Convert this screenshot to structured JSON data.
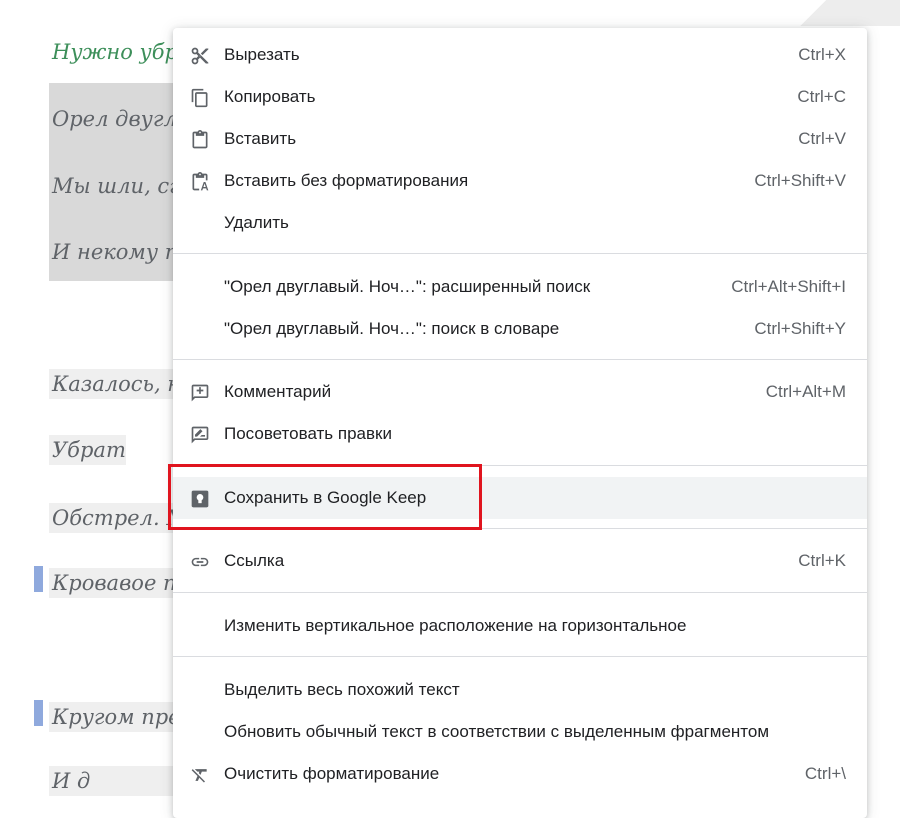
{
  "document": {
    "lines": [
      "Нужно убрать",
      "Орел двуглав",
      "Мы шли, сгу",
      "И некому по",
      "Казалось, не",
      "Убрать",
      "Обстрел. Ма",
      "Кровавое пя",
      "Кругом пред",
      "И д"
    ]
  },
  "menu": {
    "cut": {
      "label": "Вырезать",
      "shortcut": "Ctrl+X"
    },
    "copy": {
      "label": "Копировать",
      "shortcut": "Ctrl+C"
    },
    "paste": {
      "label": "Вставить",
      "shortcut": "Ctrl+V"
    },
    "paste_plain": {
      "label": "Вставить без форматирования",
      "shortcut": "Ctrl+Shift+V"
    },
    "delete": {
      "label": "Удалить"
    },
    "advanced_search": {
      "label": "\"Орел двуглавый. Ноч…\": расширенный поиск",
      "shortcut": "Ctrl+Alt+Shift+I"
    },
    "dictionary": {
      "label": "\"Орел двуглавый. Ноч…\": поиск в словаре",
      "shortcut": "Ctrl+Shift+Y"
    },
    "comment": {
      "label": "Комментарий",
      "shortcut": "Ctrl+Alt+M"
    },
    "suggest": {
      "label": "Посоветовать правки"
    },
    "keep": {
      "label": "Сохранить в Google Keep"
    },
    "link": {
      "label": "Ссылка",
      "shortcut": "Ctrl+K"
    },
    "orientation": {
      "label": "Изменить вертикальное расположение на горизонтальное"
    },
    "select_similar": {
      "label": "Выделить весь похожий текст"
    },
    "update_style": {
      "label": "Обновить обычный текст в соответствии с выделенным фрагментом"
    },
    "clear_format": {
      "label": "Очистить форматирование",
      "shortcut": "Ctrl+\\"
    }
  },
  "colors": {
    "highlight_box": "#e0141e",
    "hover_row": "#f1f3f4",
    "icon": "#5f6368",
    "bookmark": "#8fa9dd"
  }
}
